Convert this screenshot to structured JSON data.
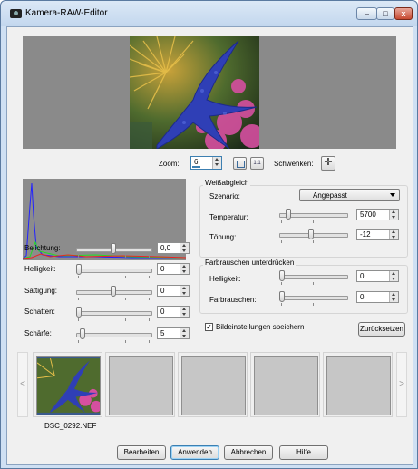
{
  "window": {
    "title": "Kamera-RAW-Editor",
    "controls": {
      "minimize": "–",
      "maximize": "□",
      "close": "x"
    }
  },
  "zoom": {
    "label": "Zoom:",
    "value": "6",
    "fit_icon": "fit-window-icon",
    "actual_size_icon": "1:1",
    "pan_label": "Schwenken:",
    "pan_icon": "move-icon"
  },
  "adjustments": [
    {
      "label": "Belichtung:",
      "value": "0,0",
      "level": 0.5
    },
    {
      "label": "Helligkeit:",
      "value": "0",
      "level": 0.0
    },
    {
      "label": "Sättigung:",
      "value": "0",
      "level": 0.5
    },
    {
      "label": "Schatten:",
      "value": "0",
      "level": 0.0
    },
    {
      "label": "Schärfe:",
      "value": "5",
      "level": 0.05
    }
  ],
  "white_balance": {
    "title": "Weißabgleich",
    "scenario_label": "Szenario:",
    "scenario_value": "Angepasst",
    "temperature_label": "Temperatur:",
    "temperature_value": "5700",
    "temperature_level": 0.1,
    "tint_label": "Tönung:",
    "tint_value": "-12",
    "tint_level": 0.47
  },
  "noise": {
    "title": "Farbrauschen unterdrücken",
    "brightness_label": "Helligkeit:",
    "brightness_value": "0",
    "brightness_level": 0.0,
    "color_noise_label": "Farbrauschen:",
    "color_noise_value": "0",
    "color_noise_level": 0.0
  },
  "save_settings": {
    "label": "Bildeinstellungen speichern",
    "checked": true
  },
  "reset_button": "Zurücksetzen",
  "filmstrip": {
    "prev": "<",
    "next": ">",
    "items": [
      {
        "label": "DSC_0292.NEF",
        "selected": true
      },
      {
        "label": ""
      },
      {
        "label": ""
      },
      {
        "label": ""
      },
      {
        "label": ""
      }
    ]
  },
  "footer": {
    "edit": "Bearbeiten",
    "apply": "Anwenden",
    "cancel": "Abbrechen",
    "help": "Hilfe"
  },
  "colors": {
    "accent": "#3c7fb1",
    "preview_bg": "#8a8a8a",
    "histogram_bg": "#8c8c8c"
  }
}
